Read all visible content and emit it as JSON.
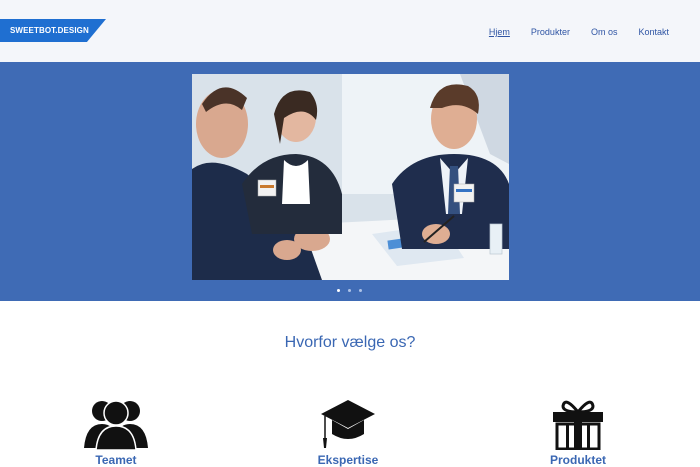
{
  "header": {
    "logo_text": "SWEETBOT.DESIGN",
    "nav": [
      {
        "label": "Hjem",
        "active": true
      },
      {
        "label": "Produkter",
        "active": false
      },
      {
        "label": "Om os",
        "active": false
      },
      {
        "label": "Kontakt",
        "active": false
      }
    ]
  },
  "hero": {
    "image": "business-meeting-photo",
    "slides": 3,
    "active_slide": 1
  },
  "why": {
    "title": "Hvorfor vælge os?",
    "features": [
      {
        "label": "Teamet",
        "icon": "team-icon"
      },
      {
        "label": "Ekspertise",
        "icon": "graduation-cap-icon"
      },
      {
        "label": "Produktet",
        "icon": "gift-icon"
      }
    ]
  },
  "colors": {
    "brand": "#1f6fd1",
    "hero_bg": "#3f6bb5",
    "link": "#2f55a4",
    "heading": "#3a67b3"
  }
}
